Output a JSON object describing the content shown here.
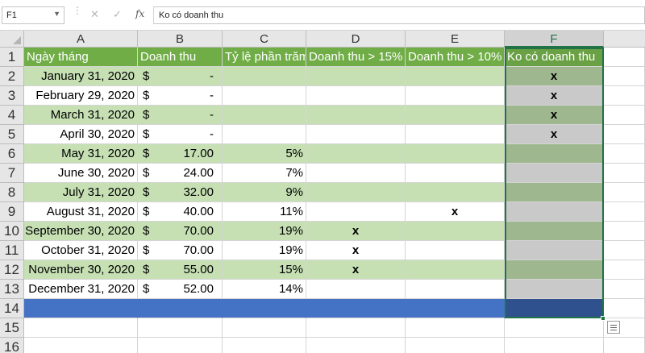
{
  "formula_bar": {
    "name_box": "F1",
    "cancel_icon": "✕",
    "enter_icon": "✓",
    "fx_label": "fx",
    "content": "Ko có doanh thu"
  },
  "columns": [
    "A",
    "B",
    "C",
    "D",
    "E",
    "F"
  ],
  "selected_column": "F",
  "row_numbers": [
    "1",
    "2",
    "3",
    "4",
    "5",
    "6",
    "7",
    "8",
    "9",
    "10",
    "11",
    "12",
    "13",
    "14",
    "15",
    "16"
  ],
  "header_row": {
    "a": "Ngày tháng",
    "b": "Doanh thu",
    "c": "Tỷ lệ phần trăm",
    "d": "Doanh thu > 15%",
    "e": "Doanh thu > 10%",
    "f": "Ko có doanh thu"
  },
  "rows": [
    {
      "date": "January 31, 2020",
      "cur": "$",
      "rev": "-",
      "pct": "",
      "d": "",
      "e": "",
      "f": "x"
    },
    {
      "date": "February 29, 2020",
      "cur": "$",
      "rev": "-",
      "pct": "",
      "d": "",
      "e": "",
      "f": "x"
    },
    {
      "date": "March 31, 2020",
      "cur": "$",
      "rev": "-",
      "pct": "",
      "d": "",
      "e": "",
      "f": "x"
    },
    {
      "date": "April 30, 2020",
      "cur": "$",
      "rev": "-",
      "pct": "",
      "d": "",
      "e": "",
      "f": "x"
    },
    {
      "date": "May 31, 2020",
      "cur": "$",
      "rev": "17.00",
      "pct": "5%",
      "d": "",
      "e": "",
      "f": ""
    },
    {
      "date": "June 30, 2020",
      "cur": "$",
      "rev": "24.00",
      "pct": "7%",
      "d": "",
      "e": "",
      "f": ""
    },
    {
      "date": "July 31, 2020",
      "cur": "$",
      "rev": "32.00",
      "pct": "9%",
      "d": "",
      "e": "",
      "f": ""
    },
    {
      "date": "August 31, 2020",
      "cur": "$",
      "rev": "40.00",
      "pct": "11%",
      "d": "",
      "e": "x",
      "f": ""
    },
    {
      "date": "September 30, 2020",
      "cur": "$",
      "rev": "70.00",
      "pct": "19%",
      "d": "x",
      "e": "",
      "f": ""
    },
    {
      "date": "October 31, 2020",
      "cur": "$",
      "rev": "70.00",
      "pct": "19%",
      "d": "x",
      "e": "",
      "f": ""
    },
    {
      "date": "November 30, 2020",
      "cur": "$",
      "rev": "55.00",
      "pct": "15%",
      "d": "x",
      "e": "",
      "f": ""
    },
    {
      "date": "December 31, 2020",
      "cur": "$",
      "rev": "52.00",
      "pct": "14%",
      "d": "",
      "e": "",
      "f": ""
    }
  ],
  "colors": {
    "header_green": "#70ad47",
    "band_green": "#c6e0b4",
    "total_blue": "#4472c4",
    "selection_green": "#217346"
  }
}
